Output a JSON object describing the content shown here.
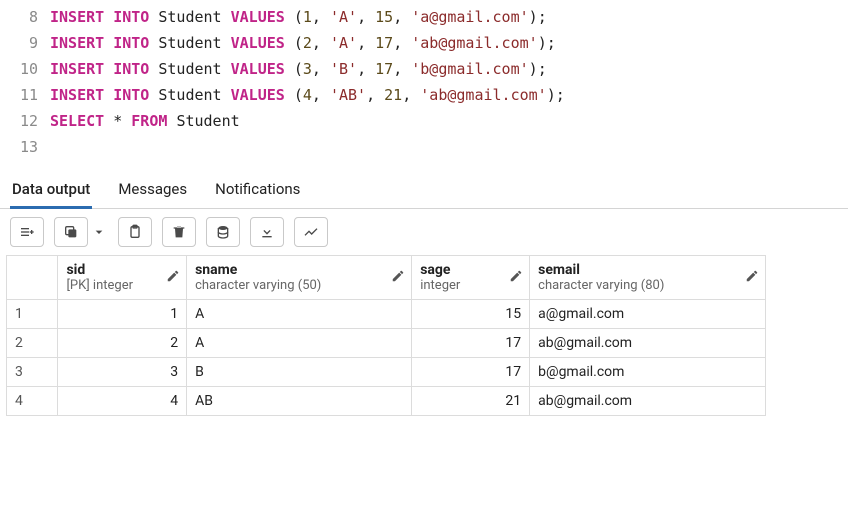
{
  "editor": {
    "lines": [
      {
        "n": 8,
        "tokens": [
          [
            "kw",
            "INSERT"
          ],
          [
            "sp",
            " "
          ],
          [
            "kw",
            "INTO"
          ],
          [
            "sp",
            " "
          ],
          [
            "ident",
            "Student"
          ],
          [
            "sp",
            " "
          ],
          [
            "kw",
            "VALUES"
          ],
          [
            "sp",
            " "
          ],
          [
            "paren",
            "("
          ],
          [
            "num",
            "1"
          ],
          [
            "punct",
            ","
          ],
          [
            "sp",
            " "
          ],
          [
            "str",
            "'A'"
          ],
          [
            "punct",
            ","
          ],
          [
            "sp",
            " "
          ],
          [
            "num",
            "15"
          ],
          [
            "punct",
            ","
          ],
          [
            "sp",
            " "
          ],
          [
            "str",
            "'a@gmail.com'"
          ],
          [
            "paren",
            ")"
          ],
          [
            "punct",
            ";"
          ]
        ]
      },
      {
        "n": 9,
        "tokens": [
          [
            "kw",
            "INSERT"
          ],
          [
            "sp",
            " "
          ],
          [
            "kw",
            "INTO"
          ],
          [
            "sp",
            " "
          ],
          [
            "ident",
            "Student"
          ],
          [
            "sp",
            " "
          ],
          [
            "kw",
            "VALUES"
          ],
          [
            "sp",
            " "
          ],
          [
            "paren",
            "("
          ],
          [
            "num",
            "2"
          ],
          [
            "punct",
            ","
          ],
          [
            "sp",
            " "
          ],
          [
            "str",
            "'A'"
          ],
          [
            "punct",
            ","
          ],
          [
            "sp",
            " "
          ],
          [
            "num",
            "17"
          ],
          [
            "punct",
            ","
          ],
          [
            "sp",
            " "
          ],
          [
            "str",
            "'ab@gmail.com'"
          ],
          [
            "paren",
            ")"
          ],
          [
            "punct",
            ";"
          ]
        ]
      },
      {
        "n": 10,
        "tokens": [
          [
            "kw",
            "INSERT"
          ],
          [
            "sp",
            " "
          ],
          [
            "kw",
            "INTO"
          ],
          [
            "sp",
            " "
          ],
          [
            "ident",
            "Student"
          ],
          [
            "sp",
            " "
          ],
          [
            "kw",
            "VALUES"
          ],
          [
            "sp",
            " "
          ],
          [
            "paren",
            "("
          ],
          [
            "num",
            "3"
          ],
          [
            "punct",
            ","
          ],
          [
            "sp",
            " "
          ],
          [
            "str",
            "'B'"
          ],
          [
            "punct",
            ","
          ],
          [
            "sp",
            " "
          ],
          [
            "num",
            "17"
          ],
          [
            "punct",
            ","
          ],
          [
            "sp",
            " "
          ],
          [
            "str",
            "'b@gmail.com'"
          ],
          [
            "paren",
            ")"
          ],
          [
            "punct",
            ";"
          ]
        ]
      },
      {
        "n": 11,
        "tokens": [
          [
            "kw",
            "INSERT"
          ],
          [
            "sp",
            " "
          ],
          [
            "kw",
            "INTO"
          ],
          [
            "sp",
            " "
          ],
          [
            "ident",
            "Student"
          ],
          [
            "sp",
            " "
          ],
          [
            "kw",
            "VALUES"
          ],
          [
            "sp",
            " "
          ],
          [
            "paren",
            "("
          ],
          [
            "num",
            "4"
          ],
          [
            "punct",
            ","
          ],
          [
            "sp",
            " "
          ],
          [
            "str",
            "'AB'"
          ],
          [
            "punct",
            ","
          ],
          [
            "sp",
            " "
          ],
          [
            "num",
            "21"
          ],
          [
            "punct",
            ","
          ],
          [
            "sp",
            " "
          ],
          [
            "str",
            "'ab@gmail.com'"
          ],
          [
            "paren",
            ")"
          ],
          [
            "punct",
            ";"
          ]
        ]
      },
      {
        "n": 12,
        "tokens": [
          [
            "kw",
            "SELECT"
          ],
          [
            "sp",
            " "
          ],
          [
            "op",
            "*"
          ],
          [
            "sp",
            " "
          ],
          [
            "kw",
            "FROM"
          ],
          [
            "sp",
            " "
          ],
          [
            "ident",
            "Student"
          ]
        ]
      },
      {
        "n": 13,
        "tokens": []
      }
    ]
  },
  "tabs": {
    "items": [
      "Data output",
      "Messages",
      "Notifications"
    ],
    "active": 0
  },
  "toolbar": {
    "icons": [
      "add-row",
      "copy",
      "caret-down",
      "clipboard",
      "trash",
      "database-save",
      "download",
      "chart-line"
    ]
  },
  "columns": [
    {
      "name": "sid",
      "type": "[PK] integer",
      "align": "right",
      "cls": "c-sid"
    },
    {
      "name": "sname",
      "type": "character varying (50)",
      "align": "left",
      "cls": "c-sname"
    },
    {
      "name": "sage",
      "type": "integer",
      "align": "right",
      "cls": "c-sage"
    },
    {
      "name": "semail",
      "type": "character varying (80)",
      "align": "left",
      "cls": "c-semail"
    }
  ],
  "rows": [
    {
      "n": 1,
      "sid": 1,
      "sname": "A",
      "sage": 15,
      "semail": "a@gmail.com"
    },
    {
      "n": 2,
      "sid": 2,
      "sname": "A",
      "sage": 17,
      "semail": "ab@gmail.com"
    },
    {
      "n": 3,
      "sid": 3,
      "sname": "B",
      "sage": 17,
      "semail": "b@gmail.com"
    },
    {
      "n": 4,
      "sid": 4,
      "sname": "AB",
      "sage": 21,
      "semail": "ab@gmail.com"
    }
  ]
}
